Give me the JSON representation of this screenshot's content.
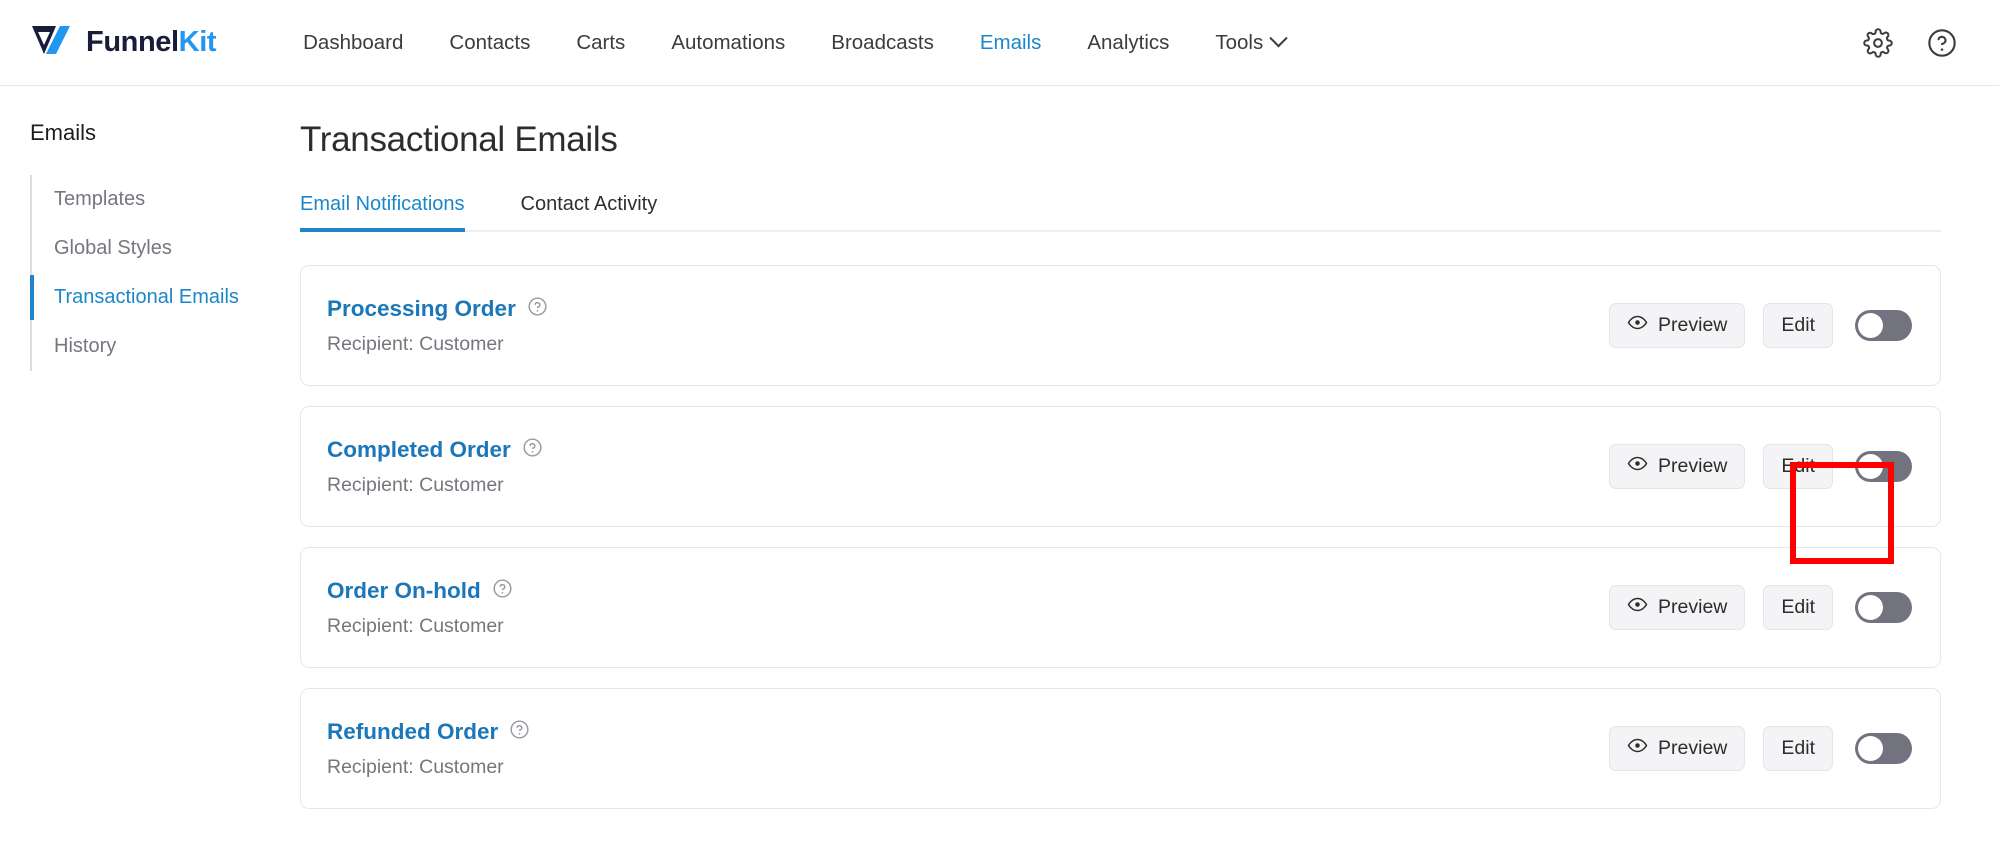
{
  "brand": {
    "name_part1": "Funnel",
    "name_part2": "Kit",
    "logo_icon": "funnelkit-logo-icon"
  },
  "topnav": {
    "items": [
      {
        "label": "Dashboard",
        "active": false,
        "has_chevron": false
      },
      {
        "label": "Contacts",
        "active": false,
        "has_chevron": false
      },
      {
        "label": "Carts",
        "active": false,
        "has_chevron": false
      },
      {
        "label": "Automations",
        "active": false,
        "has_chevron": false
      },
      {
        "label": "Broadcasts",
        "active": false,
        "has_chevron": false
      },
      {
        "label": "Emails",
        "active": true,
        "has_chevron": false
      },
      {
        "label": "Analytics",
        "active": false,
        "has_chevron": false
      },
      {
        "label": "Tools",
        "active": false,
        "has_chevron": true
      }
    ],
    "right_icons": [
      {
        "name": "gear-icon"
      },
      {
        "name": "help-circle-icon"
      }
    ]
  },
  "sidebar": {
    "title": "Emails",
    "items": [
      {
        "label": "Templates",
        "active": false
      },
      {
        "label": "Global Styles",
        "active": false
      },
      {
        "label": "Transactional Emails",
        "active": true
      },
      {
        "label": "History",
        "active": false
      }
    ]
  },
  "main": {
    "page_title": "Transactional Emails",
    "tabs": [
      {
        "label": "Email Notifications",
        "active": true
      },
      {
        "label": "Contact Activity",
        "active": false
      }
    ],
    "preview_label": "Preview",
    "edit_label": "Edit",
    "help_icon": "help-circle-icon",
    "eye_icon": "eye-icon",
    "cards": [
      {
        "title": "Processing Order",
        "recipient": "Recipient: Customer",
        "enabled": false,
        "highlighted": false
      },
      {
        "title": "Completed Order",
        "recipient": "Recipient: Customer",
        "enabled": false,
        "highlighted": true
      },
      {
        "title": "Order On-hold",
        "recipient": "Recipient: Customer",
        "enabled": false,
        "highlighted": false
      },
      {
        "title": "Refunded Order",
        "recipient": "Recipient: Customer",
        "enabled": false,
        "highlighted": false
      }
    ]
  },
  "annotation": {
    "target": "edit-button-completed-order",
    "color": "#ff0000"
  },
  "colors": {
    "accent_blue": "#1b87c9",
    "link_blue": "#1b77b8",
    "brand_navy": "#1b1b3a",
    "brand_blue": "#2196f3",
    "toggle_off": "#73737f",
    "muted_text": "#76767e"
  }
}
